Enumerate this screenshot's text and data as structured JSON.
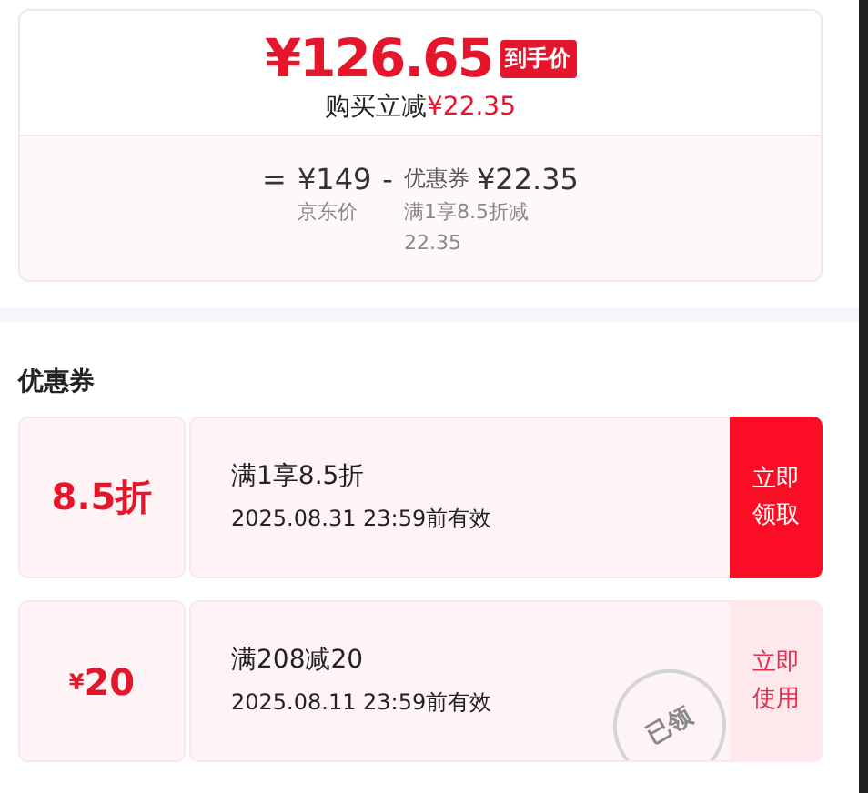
{
  "price": {
    "final": "¥126.65",
    "final_tag": "到手价",
    "saving_label": "购买立减",
    "saving_amount": "¥22.35"
  },
  "breakdown": {
    "equals": "=",
    "base_price": "¥149",
    "base_label": "京东价",
    "minus": "-",
    "coupon_label": "优惠券",
    "coupon_amount": "¥22.35",
    "coupon_note": "满1享8.5折减\n22.35"
  },
  "coupons_section": {
    "title": "优惠券",
    "coupons": [
      {
        "value": "8.5折",
        "title": "满1享8.5折",
        "validity": "2025.08.31 23:59前有效",
        "action": "立即领取",
        "claimed": false
      },
      {
        "value_prefix": "¥",
        "value": "20",
        "title": "满208减20",
        "validity": "2025.08.11 23:59前有效",
        "action": "立即使用",
        "claimed": true,
        "stamp": "已领"
      }
    ]
  }
}
